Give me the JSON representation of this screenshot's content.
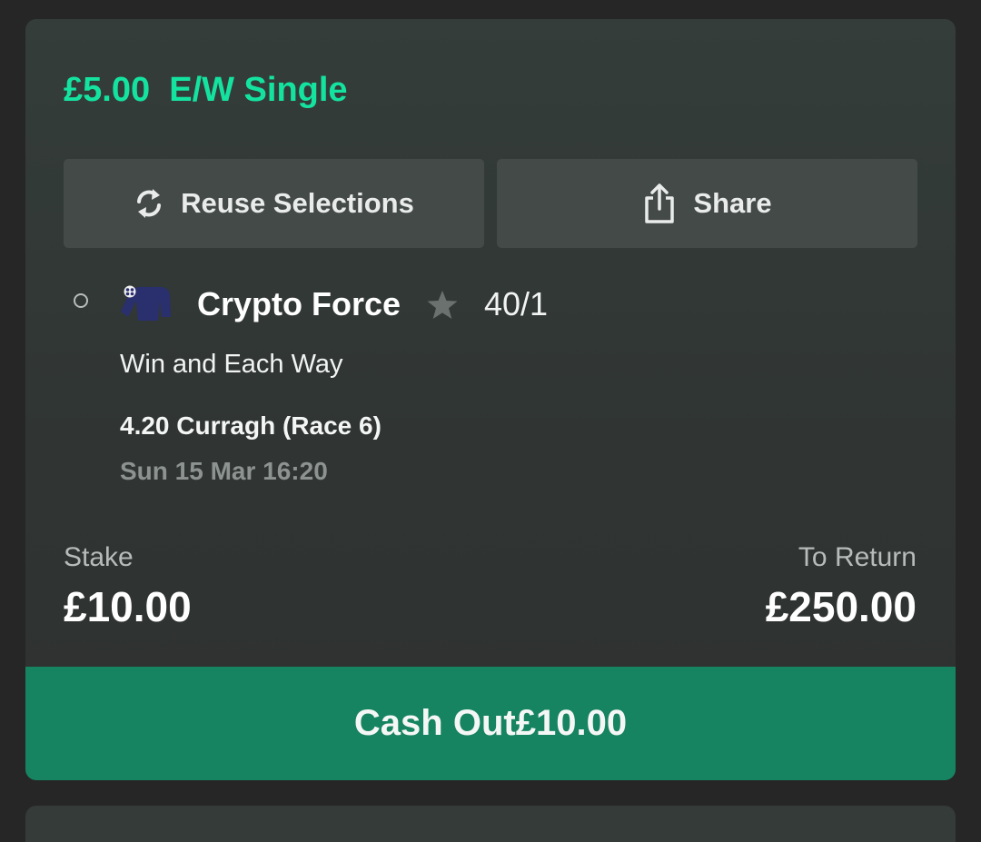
{
  "bet": {
    "stake_label": "£5.00",
    "type_label": "E/W Single"
  },
  "actions": {
    "reuse_label": "Reuse Selections",
    "share_label": "Share"
  },
  "selection": {
    "horse": "Crypto Force",
    "odds": "40/1",
    "market": "Win and Each Way",
    "race": "4.20 Curragh (Race 6)",
    "date_time": "Sun 15 Mar 16:20"
  },
  "totals": {
    "stake_label": "Stake",
    "stake_value": "£10.00",
    "return_label": "To Return",
    "return_value": "£250.00"
  },
  "cashout": {
    "label": "Cash Out",
    "amount": "£10.00"
  },
  "colors": {
    "accent_green": "#14e3a0",
    "cashout_bg": "#178461",
    "card_bg": "#343b38",
    "button_bg": "#444a48",
    "page_bg": "#262626"
  },
  "icons": [
    "refresh-icon",
    "share-icon",
    "jockey-silks-icon",
    "star-icon",
    "radio-icon"
  ]
}
